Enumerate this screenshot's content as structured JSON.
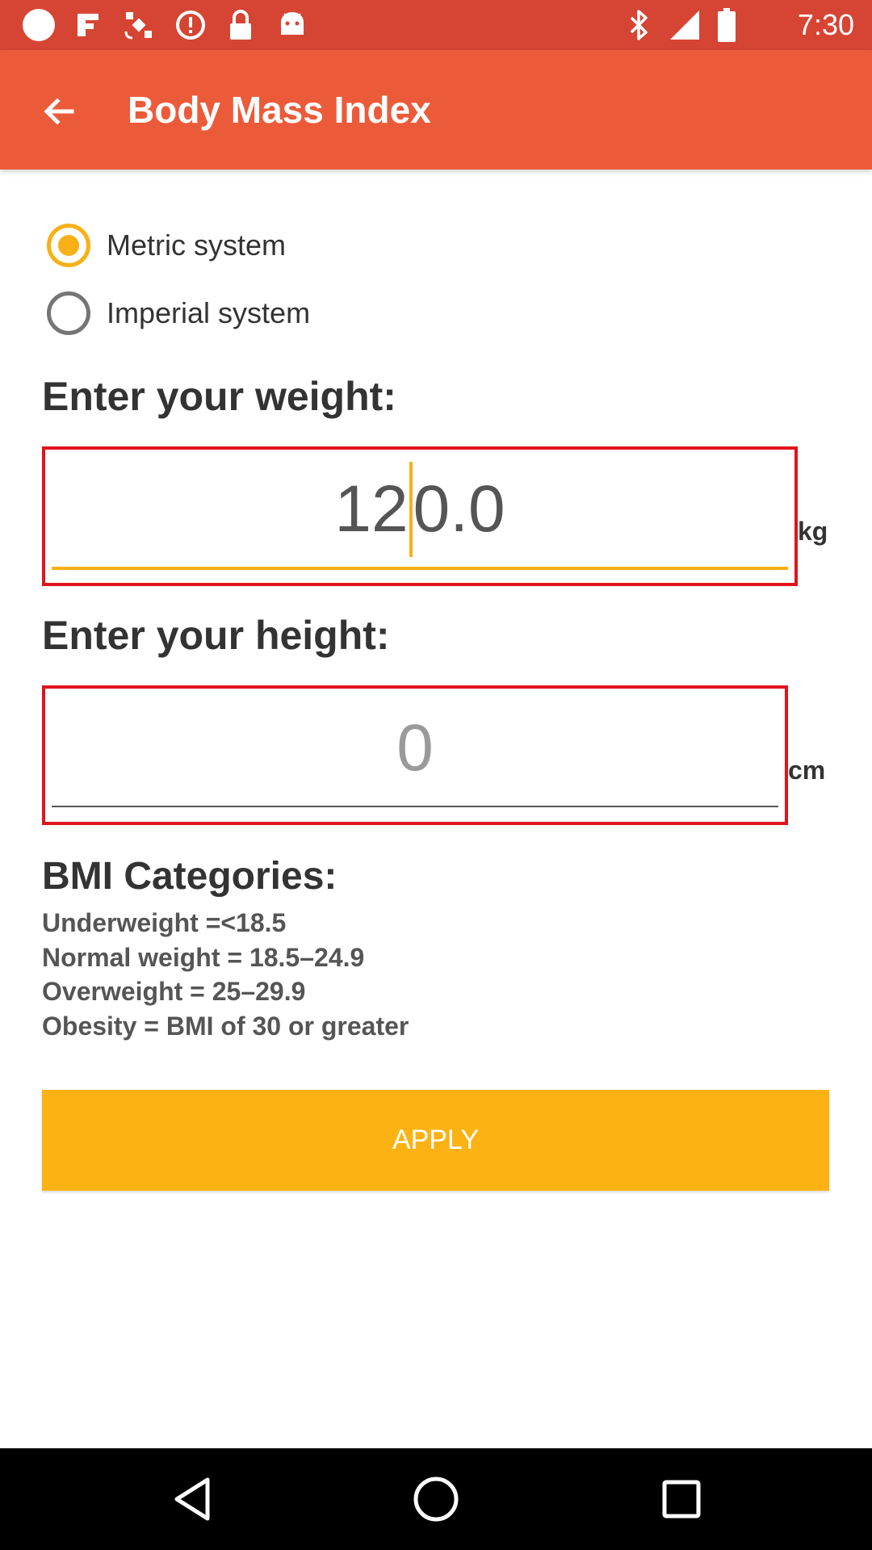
{
  "status_bar": {
    "time": "7:30",
    "icons": [
      "circle-icon",
      "fake-gps-icon",
      "satellite-icon",
      "alert-circle-icon",
      "lock-icon",
      "android-icon",
      "bluetooth-icon",
      "signal-icon",
      "battery-icon"
    ]
  },
  "app_bar": {
    "title": "Body Mass Index",
    "back_icon": "arrow-back-icon"
  },
  "unit_system": {
    "options": [
      {
        "label": "Metric system",
        "checked": true
      },
      {
        "label": "Imperial system",
        "checked": false
      }
    ]
  },
  "weight": {
    "heading": "Enter your weight:",
    "value_before_caret": "12",
    "value_after_caret": "0.0",
    "unit": "kg"
  },
  "height": {
    "heading": "Enter your height:",
    "value": "0",
    "unit": "cm"
  },
  "categories": {
    "title": "BMI Categories:",
    "lines": [
      "Underweight =<18.5",
      "Normal weight = 18.5–24.9",
      "Overweight = 25–29.9",
      "Obesity = BMI of 30 or greater"
    ]
  },
  "apply_button": {
    "label": "APPLY"
  },
  "nav_bar": {
    "icons": [
      "back-triangle-icon",
      "home-circle-icon",
      "recents-square-icon"
    ]
  },
  "colors": {
    "status_bar": "#D64534",
    "app_bar": "#EC5B39",
    "accent": "#F9B016",
    "field_border": "#E0141C",
    "button": "#FCB212"
  }
}
